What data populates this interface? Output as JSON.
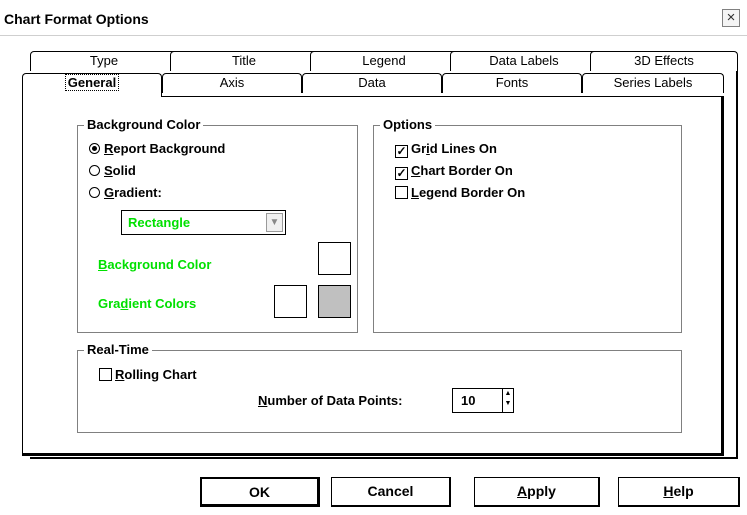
{
  "window": {
    "title": "Chart Format Options"
  },
  "tabs_back": [
    "Type",
    "Title",
    "Legend",
    "Data Labels",
    "3D Effects"
  ],
  "tabs_front": [
    "General",
    "Axis",
    "Data",
    "Fonts",
    "Series Labels"
  ],
  "background_group": {
    "legend": "Background Color",
    "radio_report": "Report Background",
    "radio_solid": "Solid",
    "radio_gradient": "Gradient:",
    "selected": "Report Background",
    "gradient_shape": "Rectangle",
    "bg_color_label": "Background Color",
    "gradient_colors_label": "Gradient Colors",
    "label_color": "#00e000",
    "gradient_color_2": "#c0c0c0"
  },
  "options_group": {
    "legend": "Options",
    "grid_lines": "Grid Lines On",
    "chart_border": "Chart Border On",
    "legend_border": "Legend Border On",
    "grid_lines_checked": true,
    "chart_border_checked": true,
    "legend_border_checked": false
  },
  "realtime_group": {
    "legend": "Real-Time",
    "rolling_chart": "Rolling Chart",
    "rolling_chart_checked": false,
    "num_points_label": "Number of Data Points:",
    "num_points_value": "10"
  },
  "buttons": {
    "ok": "OK",
    "cancel": "Cancel",
    "apply": "Apply",
    "help": "Help"
  }
}
